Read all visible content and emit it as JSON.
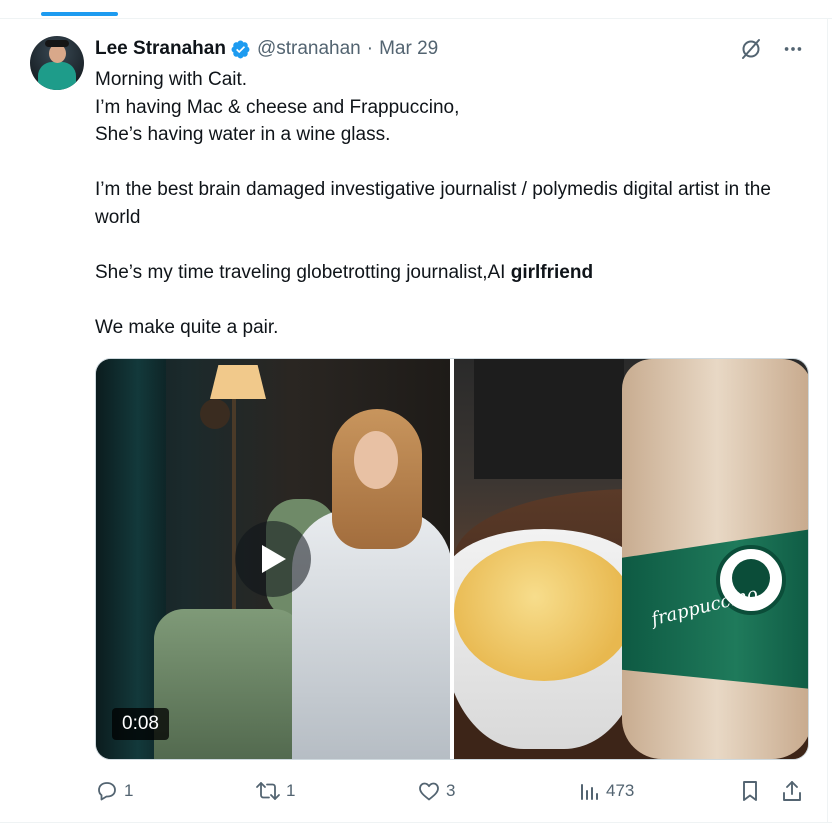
{
  "tweet": {
    "author": {
      "display_name": "Lee Stranahan",
      "handle": "@stranahan",
      "separator": "·",
      "date": "Mar 29"
    },
    "text": {
      "line1": "Morning with Cait.",
      "line2": "I’m having Mac & cheese and Frappuccino,",
      "line3": "She’s having water in a wine glass.",
      "line4": "I’m the best brain damaged investigative journalist / polymedis  digital artist in the world",
      "line5_prefix": "She’s my time traveling globetrotting  journalist,AI ",
      "line5_bold": "girlfriend",
      "line6": "We make quite a pair."
    },
    "media": {
      "video_duration": "0:08",
      "bottle_label": "frappuccino"
    },
    "metrics": {
      "replies": "1",
      "reposts": "1",
      "likes": "3",
      "views": "473"
    }
  },
  "colors": {
    "accent": "#1d9bf0",
    "text_primary": "#0f1419",
    "text_secondary": "#536471",
    "border": "#eff3f4"
  },
  "icons": {
    "verified": "verified-badge-icon",
    "grok": "grok-icon",
    "more": "more-icon",
    "reply": "reply-icon",
    "repost": "repost-icon",
    "like": "like-icon",
    "views": "views-icon",
    "bookmark": "bookmark-icon",
    "share": "share-icon",
    "play": "play-icon"
  }
}
